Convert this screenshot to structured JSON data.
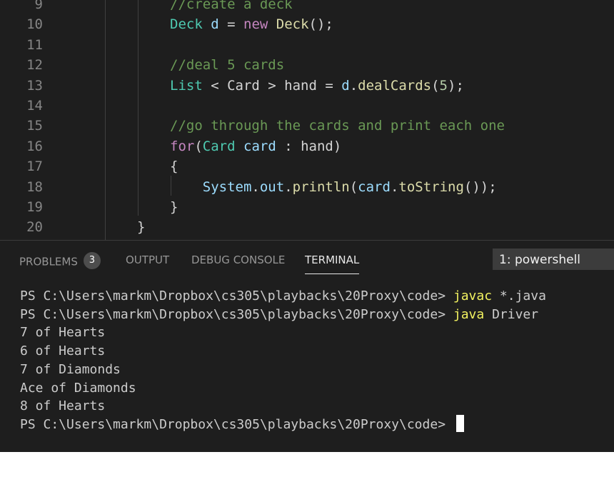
{
  "editor": {
    "lines": [
      {
        "num": "9",
        "tokens": [
          {
            "t": "//create a deck",
            "c": "comment"
          }
        ]
      },
      {
        "num": "10",
        "tokens": [
          {
            "t": "Deck",
            "c": "type"
          },
          {
            "t": " ",
            "c": "plain"
          },
          {
            "t": "d",
            "c": "var"
          },
          {
            "t": " = ",
            "c": "plain"
          },
          {
            "t": "new",
            "c": "kw"
          },
          {
            "t": " ",
            "c": "plain"
          },
          {
            "t": "Deck",
            "c": "fn"
          },
          {
            "t": "();",
            "c": "plain"
          }
        ]
      },
      {
        "num": "11",
        "tokens": []
      },
      {
        "num": "12",
        "tokens": [
          {
            "t": "//deal 5 cards",
            "c": "comment"
          }
        ]
      },
      {
        "num": "13",
        "tokens": [
          {
            "t": "List",
            "c": "type"
          },
          {
            "t": " < Card > hand = ",
            "c": "plain"
          },
          {
            "t": "d",
            "c": "var"
          },
          {
            "t": ".",
            "c": "plain"
          },
          {
            "t": "dealCards",
            "c": "fn"
          },
          {
            "t": "(",
            "c": "plain"
          },
          {
            "t": "5",
            "c": "num"
          },
          {
            "t": ");",
            "c": "plain"
          }
        ]
      },
      {
        "num": "14",
        "tokens": []
      },
      {
        "num": "15",
        "tokens": [
          {
            "t": "//go through the cards and print each one",
            "c": "comment"
          }
        ]
      },
      {
        "num": "16",
        "tokens": [
          {
            "t": "for",
            "c": "kw"
          },
          {
            "t": "(",
            "c": "plain"
          },
          {
            "t": "Card",
            "c": "type"
          },
          {
            "t": " ",
            "c": "plain"
          },
          {
            "t": "card",
            "c": "var"
          },
          {
            "t": " : hand)",
            "c": "plain"
          }
        ]
      },
      {
        "num": "17",
        "tokens": [
          {
            "t": "{",
            "c": "plain"
          }
        ]
      },
      {
        "num": "18",
        "tokens": [
          {
            "t": "    ",
            "c": "plain"
          },
          {
            "t": "System",
            "c": "var"
          },
          {
            "t": ".",
            "c": "plain"
          },
          {
            "t": "out",
            "c": "var"
          },
          {
            "t": ".",
            "c": "plain"
          },
          {
            "t": "println",
            "c": "fn"
          },
          {
            "t": "(",
            "c": "plain"
          },
          {
            "t": "card",
            "c": "var"
          },
          {
            "t": ".",
            "c": "plain"
          },
          {
            "t": "toString",
            "c": "fn"
          },
          {
            "t": "());",
            "c": "plain"
          }
        ]
      },
      {
        "num": "19",
        "tokens": [
          {
            "t": "}",
            "c": "plain"
          }
        ]
      },
      {
        "num": "20",
        "tokens": [
          {
            "t": "}",
            "c": "plain"
          }
        ]
      }
    ]
  },
  "panel": {
    "tabs": [
      {
        "label": "PROBLEMS",
        "badge": "3"
      },
      {
        "label": "OUTPUT"
      },
      {
        "label": "DEBUG CONSOLE"
      },
      {
        "label": "TERMINAL"
      }
    ],
    "terminal_selector": "1: powershell",
    "terminal_lines": [
      {
        "prompt": "PS C:\\Users\\markm\\Dropbox\\cs305\\playbacks\\20Proxy\\code> ",
        "cmd": "javac",
        "args": " *.java"
      },
      {
        "prompt": "PS C:\\Users\\markm\\Dropbox\\cs305\\playbacks\\20Proxy\\code> ",
        "cmd": "java",
        "args": " Driver"
      },
      {
        "text": "7 of Hearts"
      },
      {
        "text": "6 of Hearts"
      },
      {
        "text": "7 of Diamonds"
      },
      {
        "text": "Ace of Diamonds"
      },
      {
        "text": "8 of Hearts"
      },
      {
        "prompt": "PS C:\\Users\\markm\\Dropbox\\cs305\\playbacks\\20Proxy\\code> ",
        "cursor": true
      }
    ]
  },
  "colors": {
    "background": "#1e1e1e",
    "comment": "#6a9955",
    "type": "#4ec9b0",
    "keyword": "#c586c0",
    "function": "#dcdcaa",
    "variable": "#9cdcfe",
    "number": "#b5cea8",
    "terminal_command": "#f2f260"
  }
}
